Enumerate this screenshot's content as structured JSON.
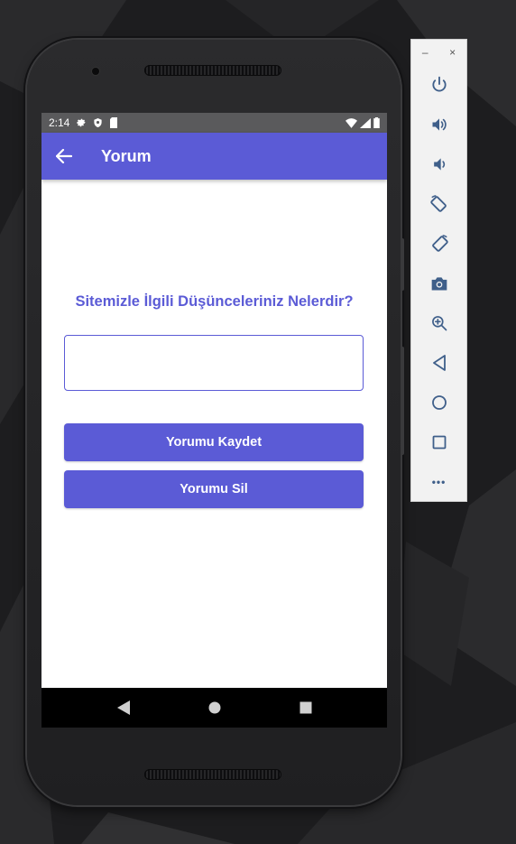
{
  "status_bar": {
    "time": "2:14"
  },
  "app_bar": {
    "title": "Yorum"
  },
  "main": {
    "question": "Sitemizle İlgili Düşünceleriniz Nelerdir?",
    "comment_value": "",
    "save_label": "Yorumu Kaydet",
    "delete_label": "Yorumu Sil"
  },
  "emulator_panel": {
    "minimize_label": "–",
    "close_label": "×",
    "more_label": "•••",
    "tools": [
      "power-icon",
      "volume-up-icon",
      "volume-down-icon",
      "rotate-left-icon",
      "rotate-right-icon",
      "camera-icon",
      "zoom-icon",
      "back-icon",
      "home-icon",
      "overview-icon",
      "more-icon"
    ]
  },
  "colors": {
    "accent": "#5b5bd6",
    "status_bar": "#5a5a5c",
    "nav_bar": "#000000",
    "panel_icon": "#3f5f8a"
  }
}
